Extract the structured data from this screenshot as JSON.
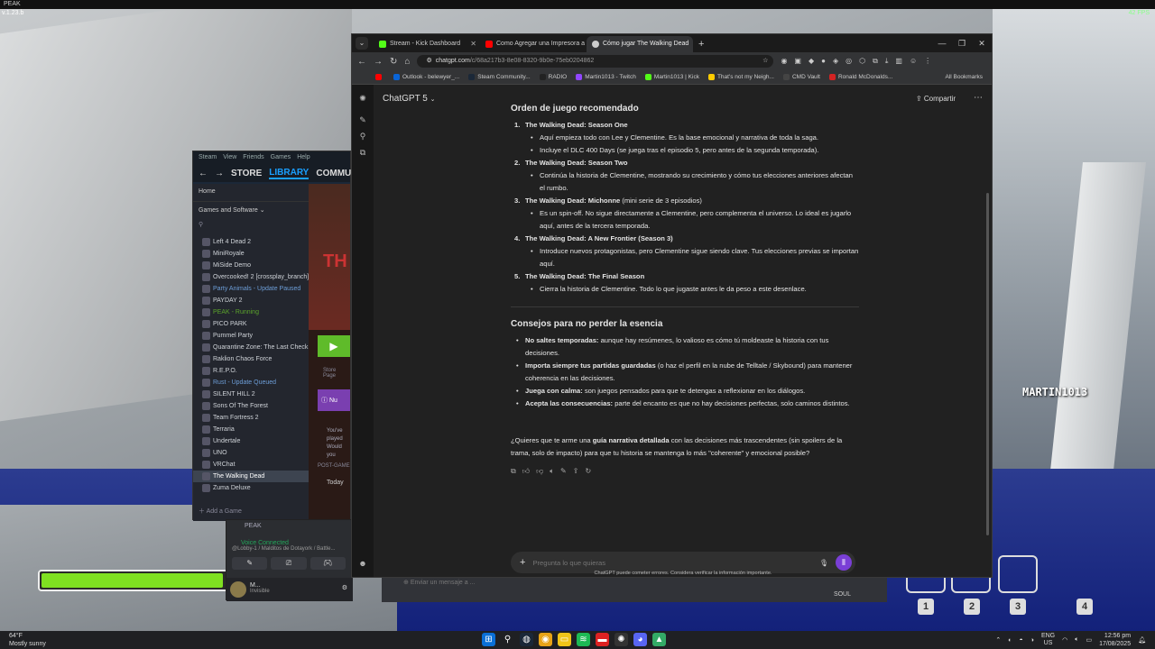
{
  "game": {
    "window_title": "PEAK",
    "version": "v.1.23.b",
    "fps": "42 FPS",
    "player_name": "MARTIN1013",
    "stamina_fraction": 0.97,
    "slots": [
      "1",
      "2",
      "3",
      "4"
    ]
  },
  "steam": {
    "menu": [
      "Steam",
      "View",
      "Friends",
      "Games",
      "Help"
    ],
    "nav": [
      "STORE",
      "LIBRARY",
      "COMMUNITY"
    ],
    "home": "Home",
    "filter": "Games and Software",
    "games": [
      {
        "name": "Left 4 Dead 2",
        "state": ""
      },
      {
        "name": "MiniRoyale",
        "state": ""
      },
      {
        "name": "MiSide Demo",
        "state": ""
      },
      {
        "name": "Overcooked! 2 [crossplay_branch]",
        "state": ""
      },
      {
        "name": "Party Animals - Update Paused",
        "state": "updating"
      },
      {
        "name": "PAYDAY 2",
        "state": ""
      },
      {
        "name": "PEAK - Running",
        "state": "running"
      },
      {
        "name": "PICO PARK",
        "state": ""
      },
      {
        "name": "Pummel Party",
        "state": ""
      },
      {
        "name": "Quarantine Zone: The Last Check",
        "state": ""
      },
      {
        "name": "Raklion Chaos Force",
        "state": ""
      },
      {
        "name": "R.E.P.O.",
        "state": ""
      },
      {
        "name": "Rust - Update Queued",
        "state": "updating"
      },
      {
        "name": "SILENT HILL 2",
        "state": ""
      },
      {
        "name": "Sons Of The Forest",
        "state": ""
      },
      {
        "name": "Team Fortress 2",
        "state": ""
      },
      {
        "name": "Terraria",
        "state": ""
      },
      {
        "name": "Undertale",
        "state": ""
      },
      {
        "name": "UNO",
        "state": ""
      },
      {
        "name": "VRChat",
        "state": ""
      },
      {
        "name": "The Walking Dead",
        "state": "selected"
      },
      {
        "name": "Zuma Deluxe",
        "state": ""
      }
    ],
    "add_game": "Add a Game",
    "banner": "TH",
    "store_page": "Store Page",
    "purple_label": "Nu",
    "you_play": "You've played\nWould you",
    "post_game": "POST-GAME",
    "today": "Today"
  },
  "discord": {
    "channel": "PEAK",
    "voice": "Voice Connected",
    "voice_sub": "@Lobby-1 / Malditos de Dotayork / Battle...",
    "user": "M...",
    "user_status": "Invisible",
    "input_placeholder": "Enviar un mensaje a ...",
    "soul": "SOUL"
  },
  "chrome": {
    "tabs": [
      {
        "title": "Stream - Kick Dashboard",
        "color": "#53fc18"
      },
      {
        "title": "Como Agregar una Impresora a",
        "color": "#ff0000"
      },
      {
        "title": "Cómo jugar The Walking Dead",
        "color": "#cccccc"
      }
    ],
    "url_host": "chatgpt.com",
    "url_path": "/c/68a217b3-8e08-8320-9b0e-75eb0204862",
    "bookmarks": [
      {
        "label": "",
        "color": "#ff0000"
      },
      {
        "label": "Outlook - belewyer_...",
        "color": "#0a64d6"
      },
      {
        "label": "Steam Community...",
        "color": "#1b2838"
      },
      {
        "label": "RADIO",
        "color": "#222222"
      },
      {
        "label": "Martin1013 - Twitch",
        "color": "#9146ff"
      },
      {
        "label": "Martin1013 | Kick",
        "color": "#53fc18"
      },
      {
        "label": "That's not my Neigh...",
        "color": "#ffcc00"
      },
      {
        "label": "CMD Vault",
        "color": "#444444"
      },
      {
        "label": "Ronald McDonalds...",
        "color": "#d32323"
      }
    ],
    "all_bookmarks": "All Bookmarks"
  },
  "gpt": {
    "model": "ChatGPT 5",
    "share": "Compartir",
    "heading1": "Orden de juego recomendado",
    "games": [
      {
        "num": "1.",
        "title": "The Walking Dead: Season One",
        "suffix": "",
        "bullets": [
          "Aquí empieza todo con Lee y Clementine. Es la base emocional y narrativa de toda la saga.",
          "Incluye el DLC 400 Days (se juega tras el episodio 5, pero antes de la segunda temporada)."
        ]
      },
      {
        "num": "2.",
        "title": "The Walking Dead: Season Two",
        "suffix": "",
        "bullets": [
          "Continúa la historia de Clementine, mostrando su crecimiento y cómo tus elecciones anteriores afectan el rumbo."
        ]
      },
      {
        "num": "3.",
        "title": "The Walking Dead: Michonne",
        "suffix": " (mini serie de 3 episodios)",
        "bullets": [
          "Es un spin-off. No sigue directamente a Clementine, pero complementa el universo. Lo ideal es jugarlo aquí, antes de la tercera temporada."
        ]
      },
      {
        "num": "4.",
        "title": "The Walking Dead: A New Frontier (Season 3)",
        "suffix": "",
        "bullets": [
          "Introduce nuevos protagonistas, pero Clementine sigue siendo clave. Tus elecciones previas se importan aquí."
        ]
      },
      {
        "num": "5.",
        "title": "The Walking Dead: The Final Season",
        "suffix": "",
        "bullets": [
          "Cierra la historia de Clementine. Todo lo que jugaste antes le da peso a este desenlace."
        ]
      }
    ],
    "heading2": "Consejos para no perder la esencia",
    "tips": [
      {
        "bold": "No saltes temporadas:",
        "text": " aunque hay resúmenes, lo valioso es cómo tú moldeaste la historia con tus decisiones."
      },
      {
        "bold": "Importa siempre tus partidas guardadas",
        "text": " (o haz el perfil en la nube de Telltale / Skybound) para mantener coherencia en las decisiones."
      },
      {
        "bold": "Juega con calma:",
        "text": " son juegos pensados para que te detengas a reflexionar en los diálogos."
      },
      {
        "bold": "Acepta las consecuencias:",
        "text": " parte del encanto es que no hay decisiones perfectas, solo caminos distintos."
      }
    ],
    "question_pre": "¿Quieres que te arme una ",
    "question_bold": "guía narrativa detallada",
    "question_post": " con las decisiones más trascendentes (sin spoilers de la trama, solo de impacto) para que tu historia se mantenga lo más \"coherente\" y emocional posible?",
    "placeholder": "Pregunta lo que quieras",
    "disclaimer": "ChatGPT puede cometer errores. Considera verificar la información importante."
  },
  "taskbar": {
    "temp": "64°F",
    "weather": "Mostly sunny",
    "lang": "ENG",
    "region": "US",
    "time": "12:56 pm",
    "date": "17/08/2025"
  }
}
